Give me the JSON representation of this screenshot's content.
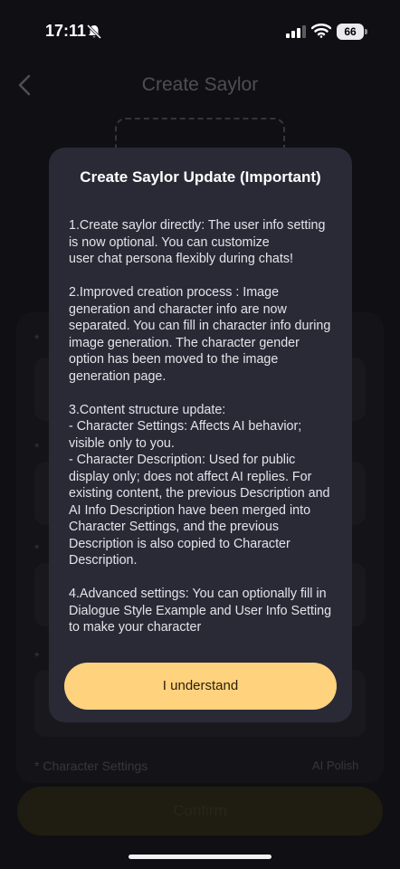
{
  "status_bar": {
    "time": "17:11",
    "battery": "66",
    "icons": [
      "bell-slash-icon",
      "signal-icon",
      "wifi-icon",
      "battery-icon"
    ]
  },
  "page": {
    "title": "Create Saylor",
    "field_star": "* ",
    "confirm_label": "Confirm",
    "character_settings_label": "* Character Settings",
    "right_hint": "AI Polish"
  },
  "modal": {
    "title": "Create Saylor Update (Important)",
    "body": "1.Create saylor directly: The user info setting is now optional. You can customize\nuser chat persona flexibly during chats!\n\n2.Improved creation process : Image generation and character info are now separated. You can fill in character info during image generation. The character gender option has been moved to the image generation page.\n\n3.Content structure update:\n- Character Settings: Affects AI behavior; visible only to you.\n- Character Description: Used for public display only; does not affect AI replies. For existing content, the previous Description and AI Info Description have been merged into Character Settings, and the previous Description is also copied to Character Description.\n\n4.Advanced settings: You can optionally fill in Dialogue Style Example and User Info Setting to make your character",
    "button_label": "I understand"
  },
  "colors": {
    "accent": "#ffd27d",
    "modal_bg": "#2a2a37",
    "page_bg": "#16161c"
  }
}
